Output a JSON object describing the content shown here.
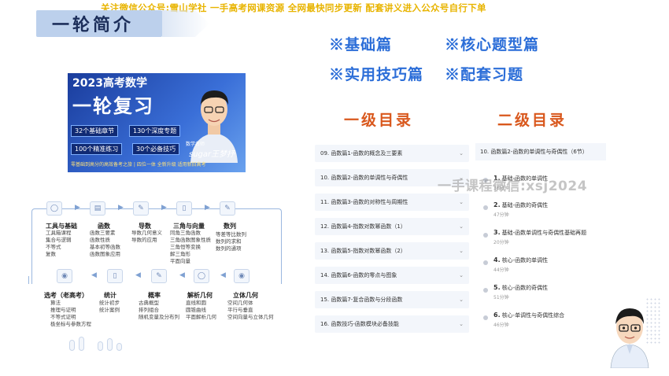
{
  "banner": "关注微信公众号:雪山学社  一手高考网课资源 全网最快同步更新 配套讲义进入公众号自行下单",
  "section_title": "一轮简介",
  "features": [
    "※基础篇",
    "※核心题型篇",
    "※实用技巧篇",
    "※配套习题"
  ],
  "cover": {
    "year": "2023高考数学",
    "title": "一轮复习",
    "chips": [
      "32个基础章节",
      "130个深度专题",
      "100个精准练习",
      "30个必备技巧"
    ],
    "footer": "零基础到高分的高效备考之旅 | 四位一体 全新升级 适用新旧高考",
    "teacher_tag": "数学名师",
    "teacher_name": "sugar王梦抒"
  },
  "flow": {
    "top": [
      {
        "icon": "user-icon",
        "head": "工具与基础",
        "items": [
          "工具箱课程",
          "集合与逻辑",
          "不等式",
          "复数"
        ]
      },
      {
        "icon": "calendar-icon",
        "head": "函数",
        "items": [
          "函数三要素",
          "函数性质",
          "基本初等函数",
          "函数图象应用"
        ]
      },
      {
        "icon": "pencil-icon",
        "head": "导数",
        "items": [
          "导数几何意义",
          "导数的应用"
        ]
      },
      {
        "icon": "clipboard-icon",
        "head": "三角与向量",
        "items": [
          "同角三角函数",
          "三角函数图象性质",
          "三角恒等变换",
          "解三角形",
          "平面向量"
        ]
      },
      {
        "icon": "pencil-icon",
        "head": "数列",
        "items": [
          "等差等比数列",
          "数列的求和",
          "数列的通项"
        ]
      }
    ],
    "bottom": [
      {
        "icon": "camera-icon",
        "head": "选考（老高考）",
        "items": [
          "算法",
          "推理与证明",
          "不等式证明",
          "极坐标与参数方程"
        ]
      },
      {
        "icon": "clipboard-icon",
        "head": "统计",
        "items": [
          "统计初步",
          "统计案例"
        ]
      },
      {
        "icon": "pencil-icon",
        "head": "概率",
        "items": [
          "古典概型",
          "排列组合",
          "随机变量及分布列"
        ]
      },
      {
        "icon": "user-icon",
        "head": "解析几何",
        "items": [
          "直线和圆",
          "圆锥曲线",
          "平面解析几何"
        ]
      },
      {
        "icon": "camera-icon",
        "head": "立体几何",
        "items": [
          "空间几何体",
          "平行与垂直",
          "空间向量与立体几何"
        ]
      }
    ]
  },
  "level1_heading": "一级目录",
  "level2_heading": "二级目录",
  "level1": [
    "09. 函数篇1-函数的概念及三要素",
    "10. 函数篇2-函数的单调性与奇偶性",
    "11. 函数篇3-函数的对称性与周期性",
    "12. 函数篇4-指数对数幂函数（1）",
    "13. 函数篇5-指数对数幂函数（2）",
    "14. 函数篇6-函数的零点与图象",
    "15. 函数篇7-复合函数与分段函数",
    "16. 函数技巧-函数模块必备技能"
  ],
  "level2_head": "10. 函数篇2-函数的单调性与奇偶性（6节）",
  "level2": [
    {
      "num": "1.",
      "title": "基础-函数的单调性",
      "dur": "36分钟"
    },
    {
      "num": "2.",
      "title": "基础-函数的奇偶性",
      "dur": "47分钟"
    },
    {
      "num": "3.",
      "title": "基础-函数单调性与奇偶性基础再题",
      "dur": "20分钟"
    },
    {
      "num": "4.",
      "title": "核心-函数的单调性",
      "dur": "44分钟"
    },
    {
      "num": "5.",
      "title": "核心-函数的奇偶性",
      "dur": "51分钟"
    },
    {
      "num": "6.",
      "title": "核心-单调性与奇偶性综合",
      "dur": "46分钟"
    }
  ],
  "watermark": "一手课程微信:xsj2024",
  "colors": {
    "feature": "#2c6ed8",
    "level_heading": "#d9581d",
    "banner": "#e8b400"
  }
}
